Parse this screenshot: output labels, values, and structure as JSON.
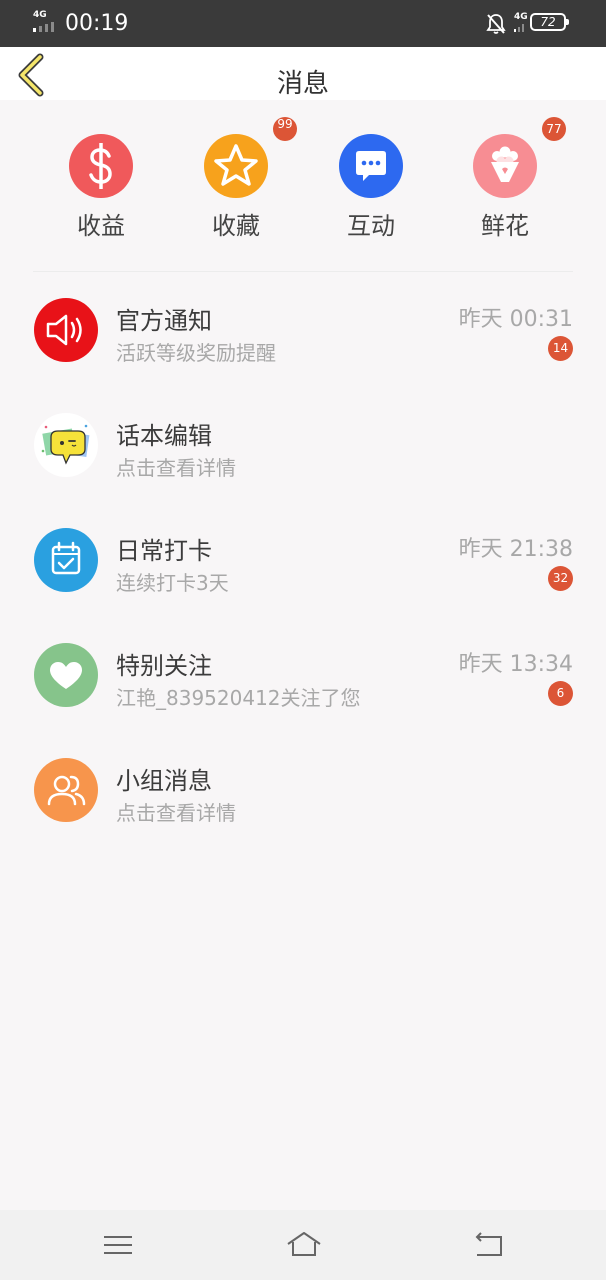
{
  "status_bar": {
    "network_left": "4G",
    "time": "00:19",
    "network_right": "4G",
    "battery": "72"
  },
  "header": {
    "title": "消息",
    "back_icon": "chevron-left-icon"
  },
  "quick_actions": [
    {
      "label": "收益",
      "icon": "dollar-icon",
      "color": "#f0595b",
      "badge": ""
    },
    {
      "label": "收藏",
      "icon": "star-icon",
      "color": "#f7a21c",
      "badge": "99"
    },
    {
      "label": "互动",
      "icon": "chat-bubble-icon",
      "color": "#2d69f0",
      "badge": ""
    },
    {
      "label": "鲜花",
      "icon": "bouquet-icon",
      "color": "#f78d93",
      "badge": "77"
    }
  ],
  "messages": [
    {
      "title": "官方通知",
      "subtitle": "活跃等级奖励提醒",
      "time": "昨天 00:31",
      "badge": "14",
      "icon": "speaker-icon",
      "color": "#e81218"
    },
    {
      "title": "话本编辑",
      "subtitle": "点击查看详情",
      "time": "",
      "badge": "",
      "icon": "editor-avatar-icon",
      "color": "#ffffff"
    },
    {
      "title": "日常打卡",
      "subtitle": "连续打卡3天",
      "time": "昨天 21:38",
      "badge": "32",
      "icon": "calendar-check-icon",
      "color": "#2aa0e0"
    },
    {
      "title": "特别关注",
      "subtitle": "江艳_839520412关注了您",
      "time": "昨天 13:34",
      "badge": "6",
      "icon": "heart-icon",
      "color": "#86c48b"
    },
    {
      "title": "小组消息",
      "subtitle": "点击查看详情",
      "time": "",
      "badge": "",
      "icon": "group-icon",
      "color": "#f7954c"
    }
  ],
  "nav_bar": {
    "menu_icon": "menu-icon",
    "home_icon": "home-icon",
    "back_icon": "back-icon"
  }
}
